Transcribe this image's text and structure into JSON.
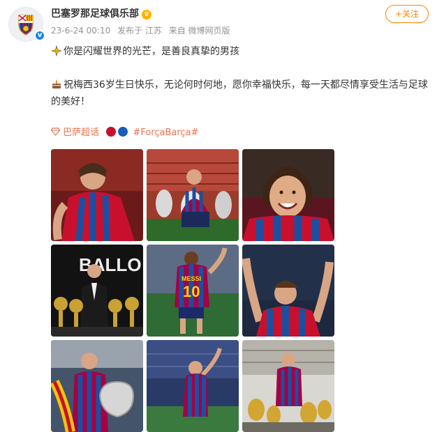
{
  "account": {
    "username": "巴塞罗那足球俱乐部",
    "avatar_icon": "fc-barcelona-crest-icon",
    "verified_icon": "verified-v-icon",
    "member_icon": "crown-icon",
    "member_glyph": "♛"
  },
  "post_meta": {
    "timestamp": "23-6-24 00:10",
    "location": "发布于 江苏",
    "source": "来自 微博网页版"
  },
  "follow_button": {
    "label": "+关注"
  },
  "post": {
    "line1": "你是闪耀世界的光芒，是善良真挚的男孩",
    "line2": "祝梅西36岁生日快乐，无论何时何地，愿你幸福快乐，每一天都尽情享受生活与足球的美好！",
    "line1_icon": "sparkle-star-icon",
    "line2_icon": "birthday-cake-icon"
  },
  "tags": {
    "topic_icon": "diamond-topic-icon",
    "topic_label": "巴萨超话",
    "hashtag": "#ForçaBarça#",
    "dot_colors": [
      "#c8102e",
      "#1b5fb8"
    ]
  },
  "photos": [
    {
      "name": "photo-celebration-red"
    },
    {
      "name": "photo-trophies"
    },
    {
      "name": "photo-smile"
    },
    {
      "name": "photo-ballon-dor"
    },
    {
      "name": "photo-number-10-back"
    },
    {
      "name": "photo-arms-raised"
    },
    {
      "name": "photo-champions-cup"
    },
    {
      "name": "photo-stadium-wave"
    },
    {
      "name": "photo-trophy-room"
    }
  ],
  "colors": {
    "accent": "#ff8200",
    "link": "#eb7350",
    "meta": "#939393",
    "barca_blue": "#1b4fa0",
    "barca_red": "#a50044"
  }
}
